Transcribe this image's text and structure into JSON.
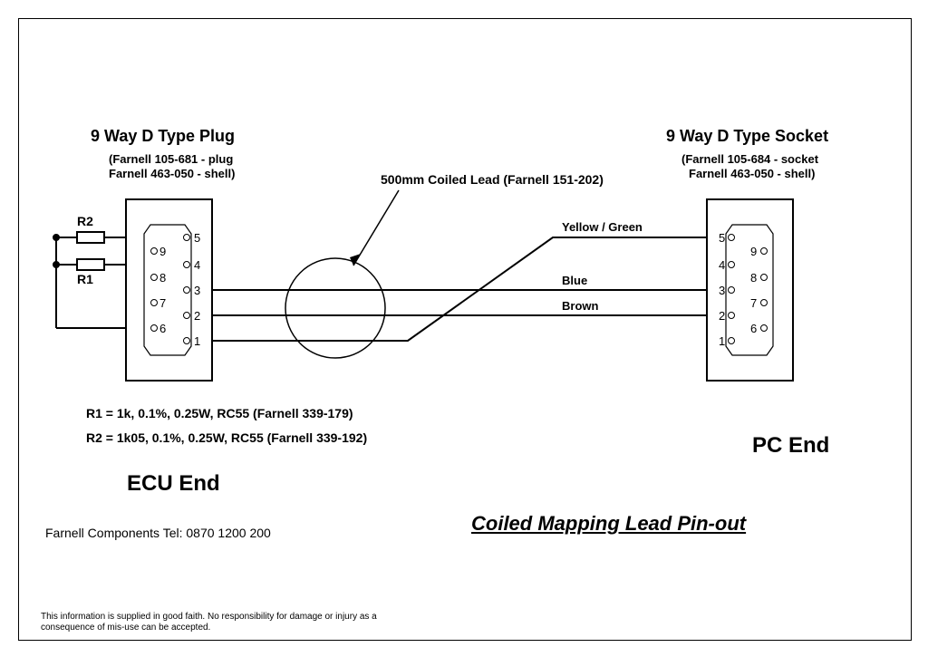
{
  "left_conn": {
    "title": "9 Way D Type Plug",
    "sub1": "(Farnell 105-681 - plug",
    "sub2": "Farnell 463-050 - shell)",
    "pins_inner": [
      "5",
      "4",
      "3",
      "2",
      "1"
    ],
    "pins_outer": [
      "9",
      "8",
      "7",
      "6"
    ]
  },
  "right_conn": {
    "title": "9 Way D Type Socket",
    "sub1": "(Farnell 105-684  - socket",
    "sub2": "Farnell 463-050 - shell)",
    "pins_inner": [
      "5",
      "4",
      "3",
      "2",
      "1"
    ],
    "pins_outer": [
      "9",
      "8",
      "7",
      "6"
    ]
  },
  "resistors": {
    "r2": "R2",
    "r1": "R1",
    "r1_spec": "R1 = 1k, 0.1%, 0.25W, RC55 (Farnell 339-179)",
    "r2_spec": "R2 = 1k05, 0.1%, 0.25W, RC55 (Farnell 339-192)"
  },
  "lead": {
    "label": "500mm Coiled Lead (Farnell 151-202)",
    "wires": {
      "yg": "Yellow / Green",
      "blue": "Blue",
      "brown": "Brown"
    }
  },
  "labels": {
    "ecu_end": "ECU End",
    "pc_end": "PC End",
    "doc_title": "Coiled Mapping Lead Pin-out",
    "supplier": "Farnell Components Tel: 0870 1200 200",
    "disclaimer1": "This information is supplied in good faith.  No responsibility for damage or injury as a",
    "disclaimer2": "consequence of mis-use can be accepted."
  }
}
